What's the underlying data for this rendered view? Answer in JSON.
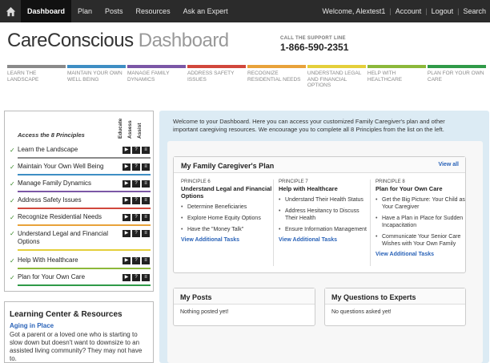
{
  "nav": {
    "items": [
      {
        "label": "Dashboard",
        "active": true
      },
      {
        "label": "Plan",
        "active": false
      },
      {
        "label": "Posts",
        "active": false
      },
      {
        "label": "Resources",
        "active": false
      },
      {
        "label": "Ask an Expert",
        "active": false
      }
    ],
    "welcome": "Welcome, Alextest1",
    "account": "Account",
    "logout": "Logout",
    "search": "Search"
  },
  "header": {
    "logo_part1": "CareConscious",
    "logo_part2": " Dashboard",
    "support_label": "CALL THE SUPPORT LINE",
    "support_number": "1-866-590-2351"
  },
  "principle_tabs": [
    {
      "label": "LEARN THE LANDSCAPE",
      "color": "#8a8a8a"
    },
    {
      "label": "MAINTAIN YOUR OWN WELL BEING",
      "color": "#3e8ec4"
    },
    {
      "label": "MANAGE FAMILY DYNAMICS",
      "color": "#7b57a6"
    },
    {
      "label": "ADDRESS SAFETY ISSUES",
      "color": "#d1473c"
    },
    {
      "label": "RECOGNIZE RESIDENTIAL NEEDS",
      "color": "#e8a23a"
    },
    {
      "label": "UNDERSTAND LEGAL AND FINANCIAL OPTIONS",
      "color": "#e4cf3a"
    },
    {
      "label": "HELP WITH HEALTHCARE",
      "color": "#8cb83a"
    },
    {
      "label": "PLAN FOR YOUR OWN CARE",
      "color": "#2f9a48"
    }
  ],
  "left_panel": {
    "col_heads": [
      "Educate",
      "Assess",
      "Assist"
    ],
    "title": "Access the 8 Principles",
    "rows": [
      {
        "label": "Learn the Landscape",
        "color": "#8a8a8a"
      },
      {
        "label": "Maintain Your Own Well Being",
        "color": "#3e8ec4"
      },
      {
        "label": "Manage Family Dynamics",
        "color": "#7b57a6"
      },
      {
        "label": "Address Safety Issues",
        "color": "#d1473c"
      },
      {
        "label": "Recognize Residential Needs",
        "color": "#e8a23a"
      },
      {
        "label": "Understand Legal and Financial Options",
        "color": "#e4cf3a"
      },
      {
        "label": "Help With Healthcare",
        "color": "#8cb83a"
      },
      {
        "label": "Plan for Your Own Care",
        "color": "#2f9a48"
      }
    ],
    "check": "✓",
    "icon_play": "▶",
    "icon_q": "?",
    "icon_list": "≡"
  },
  "learning": {
    "title": "Learning Center & Resources",
    "link": "Aging in Place",
    "text": "Got a parent or a loved one who is starting to slow down but doesn't want to downsize to an assisted living community? They may not have to."
  },
  "main": {
    "welcome": "Welcome to your Dashboard. Here you can access your customized Family Caregiver's plan and other important caregiving resources. We encourage you to complete all 8 Principles from the list on the left.",
    "plan_title": "My Family Caregiver's Plan",
    "view_all": "View all",
    "columns": [
      {
        "num": "PRINCIPLE 6",
        "name": "Understand Legal and Financial Options",
        "tasks": [
          "Determine Beneficiaries",
          "Explore Home Equity Options",
          "Have the \"Money Talk\""
        ],
        "link": "View Additional Tasks"
      },
      {
        "num": "PRINCIPLE 7",
        "name": "Help with Healthcare",
        "tasks": [
          "Understand Their Health Status",
          "Address Hesitancy to Discuss Their Health",
          "Ensure Information Management"
        ],
        "link": "View Additional Tasks"
      },
      {
        "num": "PRINCIPLE 8",
        "name": "Plan for Your Own Care",
        "tasks": [
          "Get the Big Picture: Your Child as Your Caregiver",
          "Have a Plan in Place for Sudden Incapacitation",
          "Communicate Your Senior Care Wishes with Your Own Family"
        ],
        "link": "View Additional Tasks"
      }
    ],
    "posts_title": "My Posts",
    "posts_body": "Nothing posted yet!",
    "questions_title": "My Questions to Experts",
    "questions_body": "No questions asked yet!"
  }
}
